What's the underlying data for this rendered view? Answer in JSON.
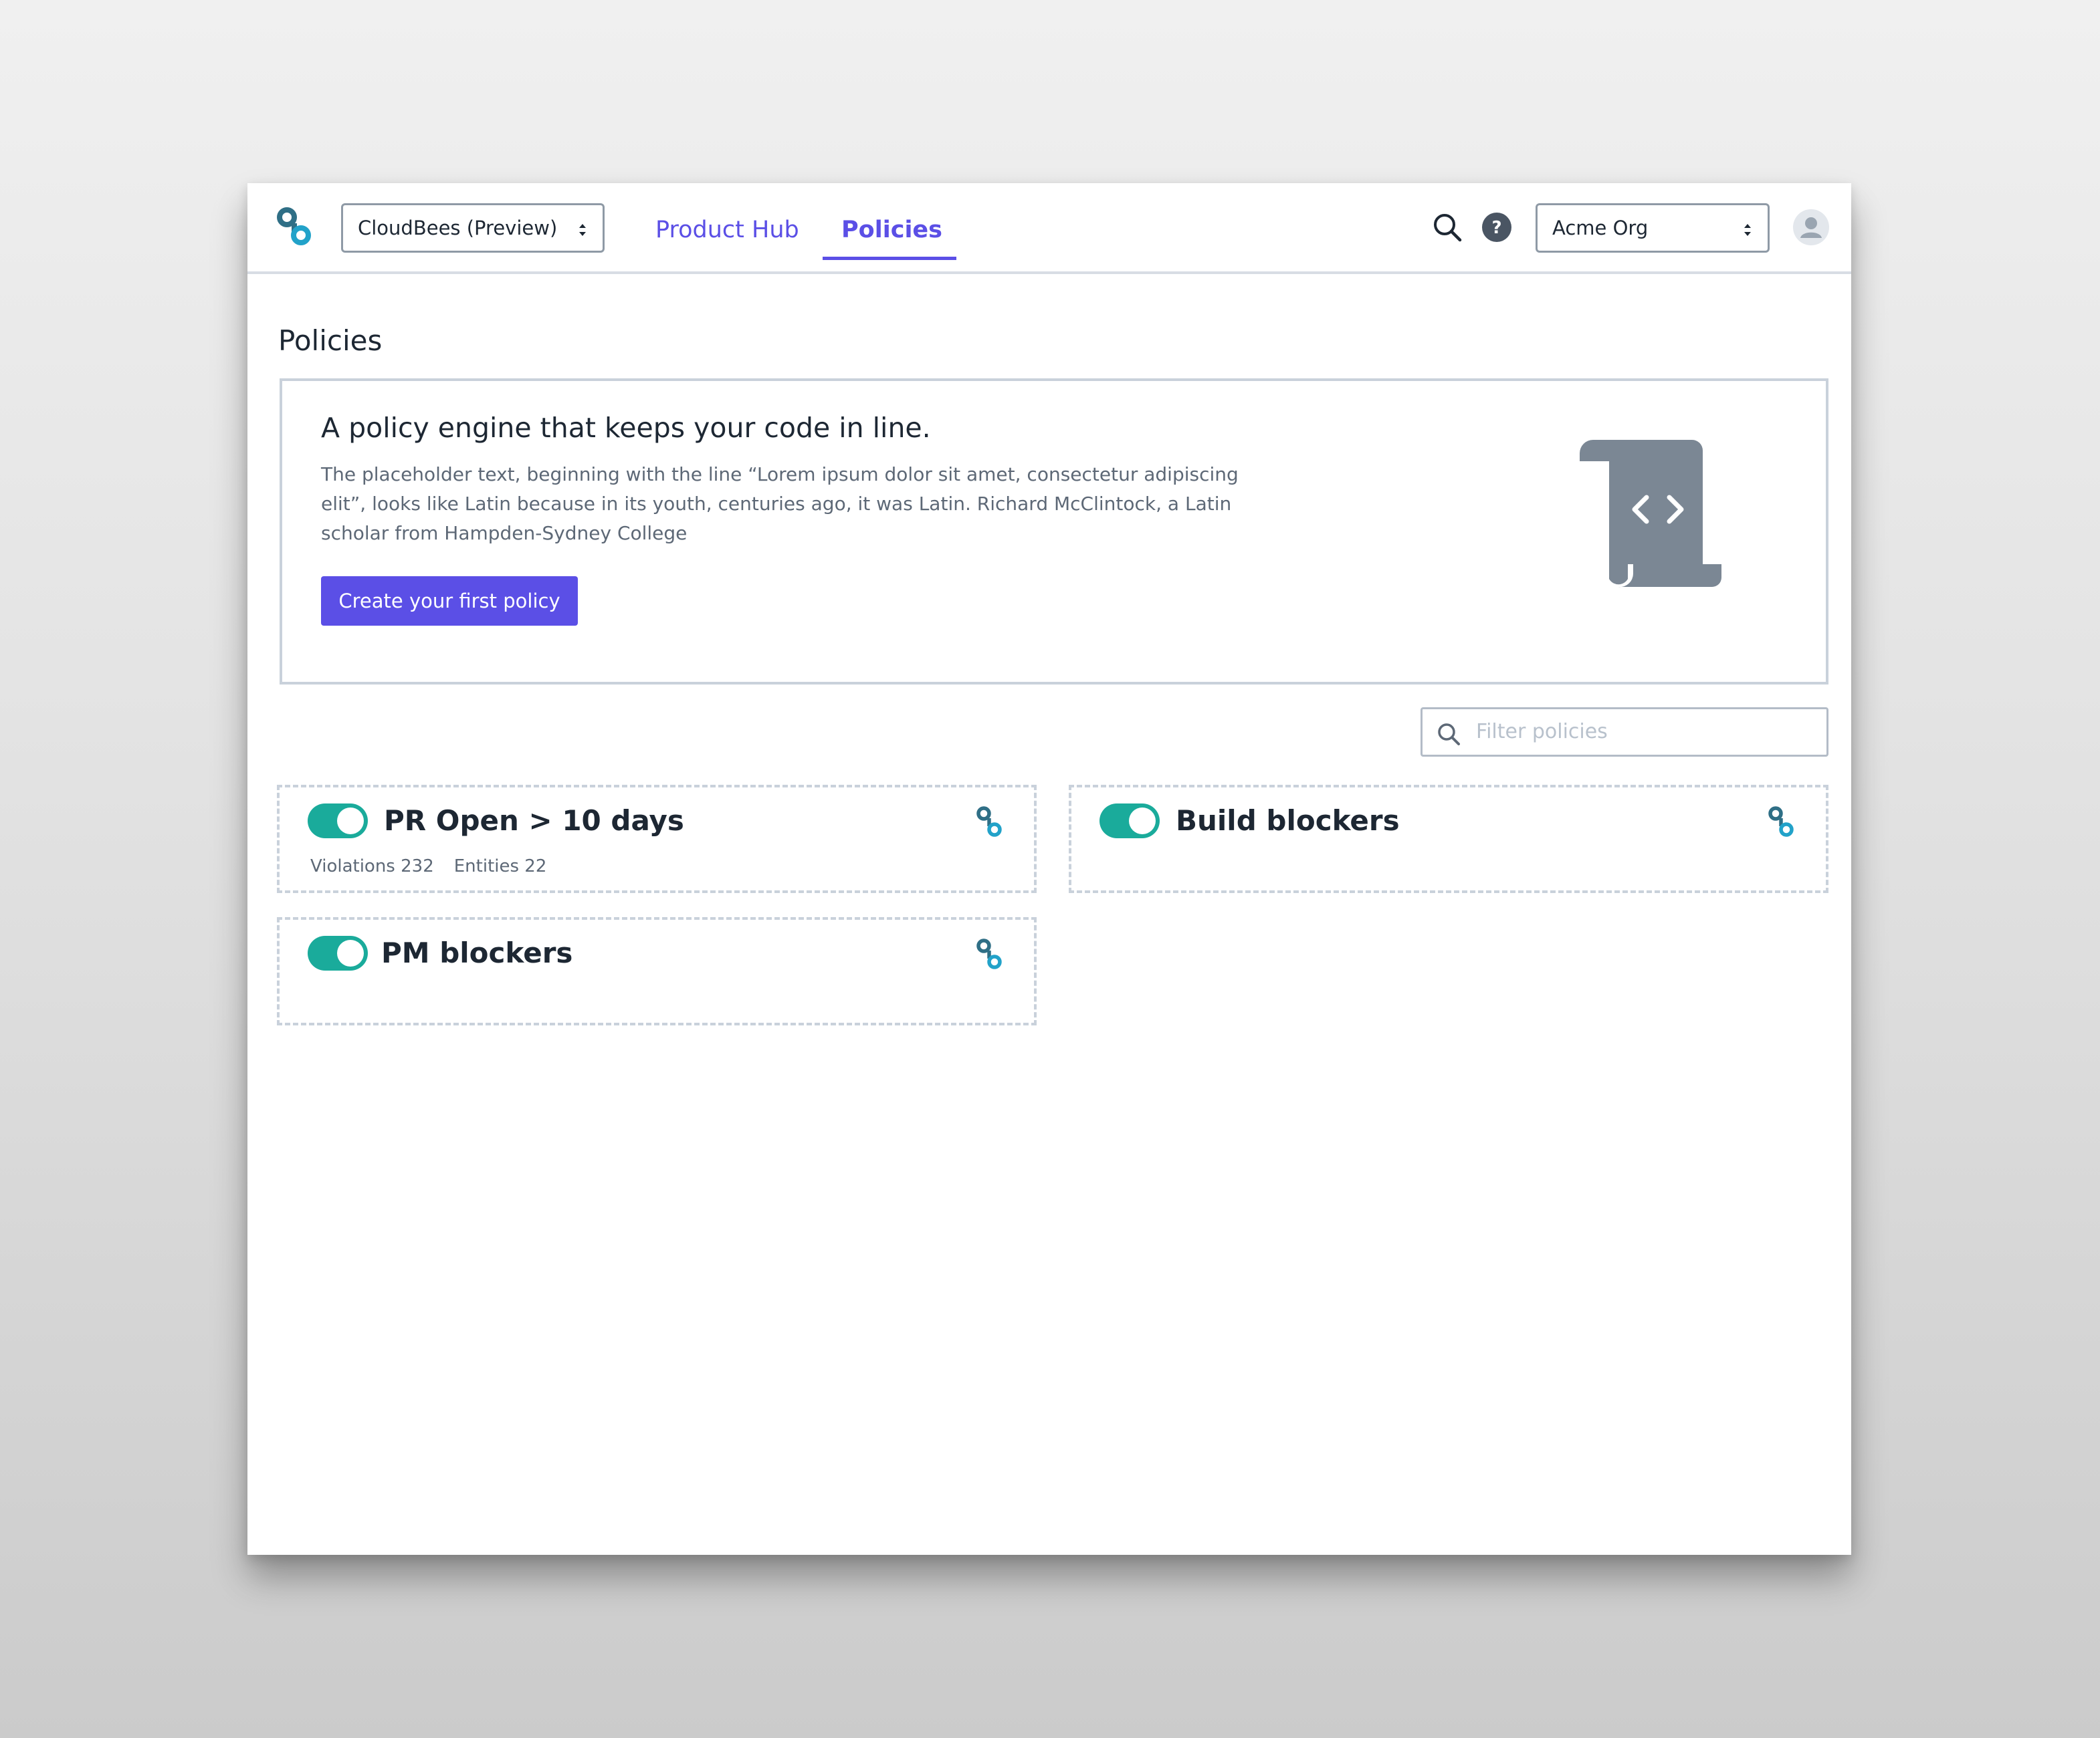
{
  "topbar": {
    "product_select": "CloudBees (Preview)",
    "tabs": [
      {
        "label": "Product Hub",
        "active": false
      },
      {
        "label": "Policies",
        "active": true
      }
    ],
    "org_select": "Acme Org"
  },
  "icons": {
    "logo": "cloudbees-logo-icon",
    "search": "search-icon",
    "help": "help-icon",
    "avatar": "avatar-icon",
    "illustration": "code-scroll-icon",
    "card_link": "cloudbees-link-icon"
  },
  "page": {
    "title": "Policies"
  },
  "hero": {
    "title": "A policy engine that keeps your code in line.",
    "body": "The placeholder text, beginning with the line “Lorem ipsum dolor sit amet, consectetur adipiscing elit”, looks like Latin because in its youth, centuries ago, it was Latin. Richard McClintock, a Latin scholar from Hampden-Sydney College",
    "button_label": "Create your first policy"
  },
  "filter": {
    "placeholder": "Filter policies"
  },
  "policies": [
    {
      "title": "PR Open > 10 days",
      "enabled": true,
      "violations": "Violations 232",
      "entities": "Entities 22"
    },
    {
      "title": "Build blockers",
      "enabled": true
    },
    {
      "title": "PM blockers",
      "enabled": true
    }
  ],
  "colors": {
    "accent": "#5b4fe6",
    "toggle_on": "#1aab9b",
    "logo_dark": "#2f6f86",
    "logo_light": "#22a2c9",
    "text": "#1d2733",
    "muted": "#5d6876",
    "border": "#c9d1db",
    "illustration": "#7b8794"
  }
}
